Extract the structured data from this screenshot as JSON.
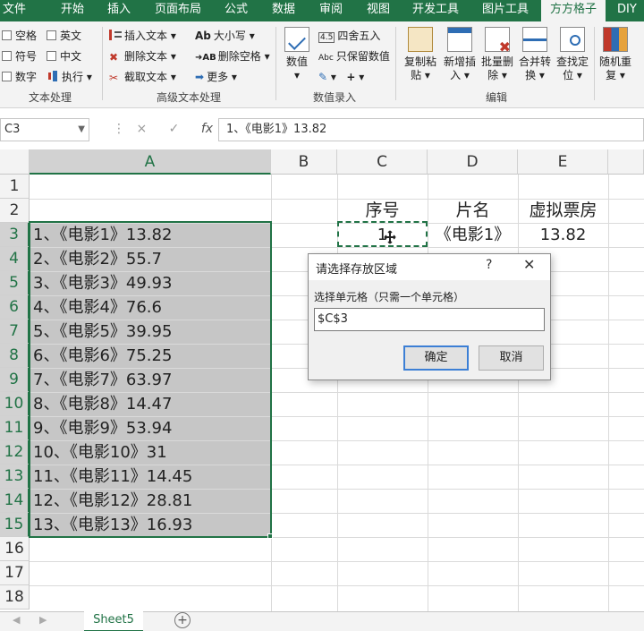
{
  "menu": {
    "tabs": [
      "文件",
      "开始",
      "插入",
      "页面布局",
      "公式",
      "数据",
      "审阅",
      "视图",
      "开发工具",
      "图片工具",
      "方方格子",
      "DIY工"
    ],
    "active_tab": "方方格子"
  },
  "ribbon": {
    "text_processing": {
      "checkboxes": [
        "空格",
        "英文",
        "符号",
        "中文",
        "数字"
      ],
      "execute": "执行",
      "group_label": "文本处理"
    },
    "advanced_text": {
      "insert_text": "插入文本",
      "delete_text": "删除文本",
      "extract_text": "截取文本",
      "case": "大小写",
      "delete_space": "删除空格",
      "more": "更多",
      "group_label": "高级文本处理"
    },
    "numeric_entry": {
      "numeric": "数值",
      "round": "四舍五入",
      "keep_value": "只保留数值",
      "group_label": "数值录入"
    },
    "edit": {
      "copy_paste": [
        "复制粘",
        "贴"
      ],
      "add_insert": [
        "新增插",
        "入"
      ],
      "batch_delete": [
        "批量删",
        "除"
      ],
      "merge_convert": [
        "合并转",
        "换"
      ],
      "find_locate": [
        "查找定",
        "位"
      ],
      "random_repeat": [
        "随机重",
        "复"
      ],
      "group_label": "编辑"
    }
  },
  "formula_bar": {
    "name_box": "C3",
    "formula": "1、《电影1》13.82",
    "cancel_icon": "×",
    "confirm_icon": "✓",
    "fx": "fx"
  },
  "sheet": {
    "columns": [
      "A",
      "B",
      "C",
      "D",
      "E"
    ],
    "rows": [
      "1",
      "2",
      "3",
      "4",
      "5",
      "6",
      "7",
      "8",
      "9",
      "10",
      "11",
      "12",
      "13",
      "14",
      "15",
      "16",
      "17",
      "18"
    ],
    "column_a": [
      "1、《电影1》13.82",
      "2、《电影2》55.7",
      "3、《电影3》49.93",
      "4、《电影4》76.6",
      "5、《电影5》39.95",
      "6、《电影6》75.25",
      "7、《电影7》63.97",
      "8、《电影8》14.47",
      "9、《电影9》53.94",
      "10、《电影10》31",
      "11、《电影11》14.45",
      "12、《电影12》28.81",
      "13、《电影13》16.93"
    ],
    "headers": {
      "c2": "序号",
      "d2": "片名",
      "e2": "虚拟票房"
    },
    "row3": {
      "c3": "1",
      "d3": "《电影1》",
      "e3": "13.82"
    }
  },
  "dialog": {
    "title": "请选择存放区域",
    "help": "?",
    "close": "✕",
    "label": "选择单元格（只需一个单元格）",
    "input_value": "$C$3",
    "ok": "确定",
    "cancel": "取消"
  },
  "sheet_tabs": {
    "active": "Sheet5",
    "add": "+"
  },
  "colors": {
    "accent": "#217346",
    "selection_fill": "#c6c6c6"
  }
}
